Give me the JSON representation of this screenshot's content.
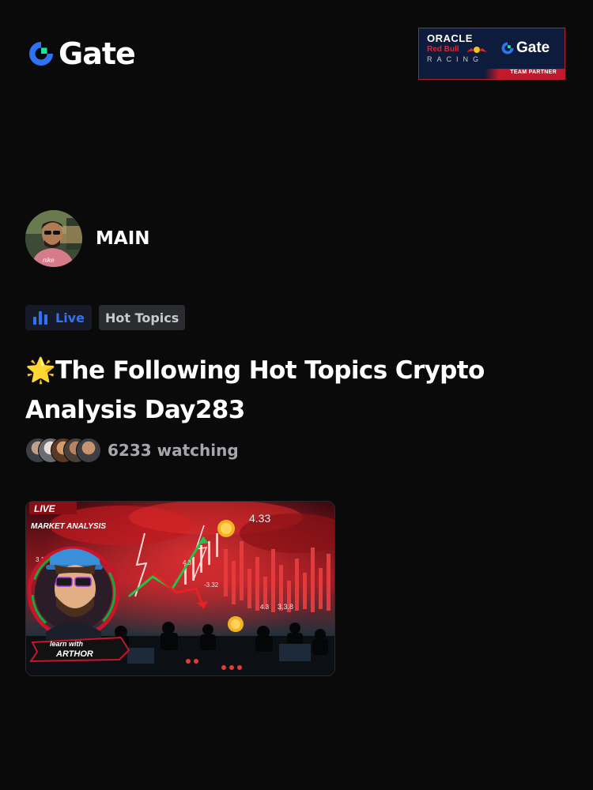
{
  "header": {
    "brand_name": "Gate",
    "brand_icon": "gate-logo-icon",
    "partner": {
      "line1": "ORACLE",
      "line2": "Red Bull",
      "line3": "RACING",
      "brand_name": "Gate",
      "strip": "TEAM PARTNER"
    }
  },
  "profile": {
    "name": "MAIN",
    "avatar_icon": "user-avatar"
  },
  "tags": {
    "live_label": "Live",
    "live_icon": "live-bars-icon",
    "topic_label": "Hot Topics"
  },
  "post": {
    "title_emoji": "🌟",
    "title_text": "The Following Hot Topics Crypto Analysis Day283"
  },
  "viewers": {
    "watching_text": "6233 watching"
  },
  "thumbnail": {
    "badge": "LIVE",
    "heading": "MARKET ANALYSIS",
    "caption_line1": "learn with",
    "caption_line2": "ARTHOR",
    "price_labels": [
      "4.33",
      "4.3",
      "-3.32",
      "4.3",
      "3.3.8"
    ]
  },
  "colors": {
    "background": "#0a0a0b",
    "accent_blue": "#2f73f5",
    "muted_text": "#a6a7ad",
    "partner_navy": "#0d1b3c",
    "partner_red": "#c2192c"
  }
}
